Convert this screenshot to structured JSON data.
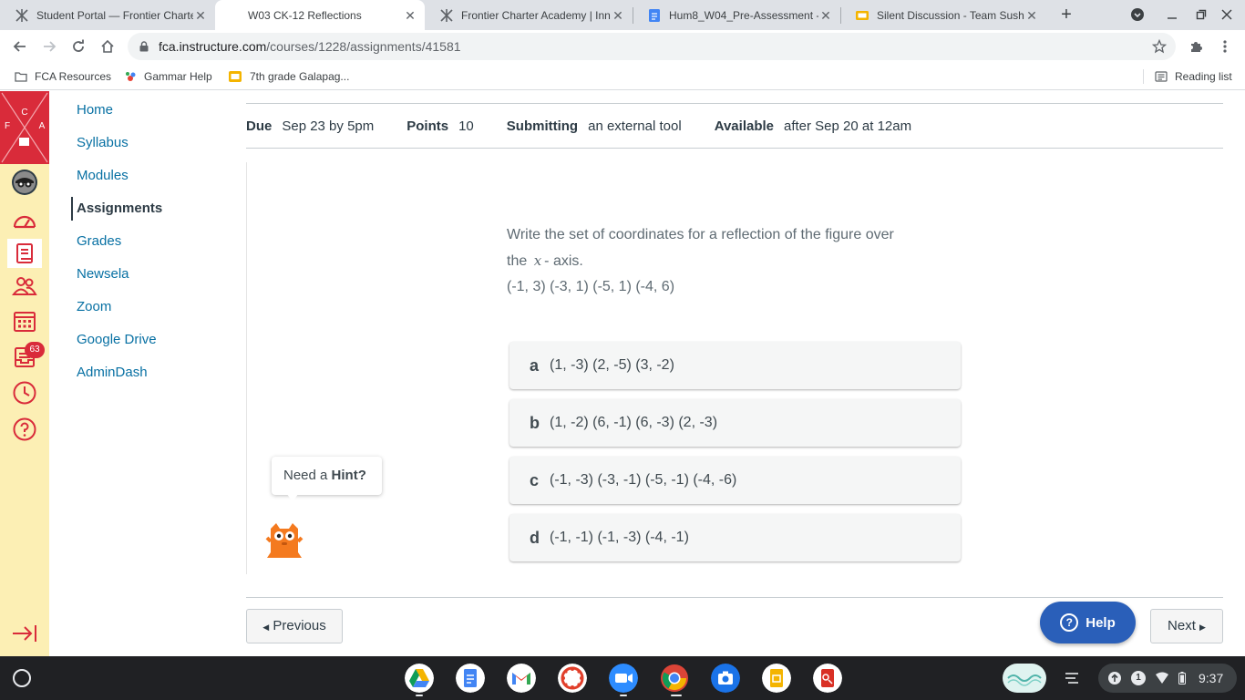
{
  "browser": {
    "tabs": [
      {
        "title": "Student Portal — Frontier Charter",
        "active": false
      },
      {
        "title": "W03 CK-12 Reflections",
        "active": true
      },
      {
        "title": "Frontier Charter Academy | Inn",
        "active": false
      },
      {
        "title": "Hum8_W04_Pre-Assessment -",
        "active": false
      },
      {
        "title": "Silent Discussion - Team Sushi",
        "active": false
      }
    ],
    "url_host": "fca.instructure.com",
    "url_path": "/courses/1228/assignments/41581",
    "bookmarks": [
      "FCA Resources",
      "Gammar Help",
      "7th grade Galapag..."
    ],
    "reading_list": "Reading list",
    "colors": {
      "tabstrip": "#dee1e6",
      "omnibox": "#f1f3f4"
    }
  },
  "global_nav": {
    "brand_letters": [
      "C",
      "F",
      "A"
    ],
    "icons": [
      "account-icon",
      "dashboard-icon",
      "courses-icon",
      "groups-icon",
      "calendar-icon",
      "inbox-icon",
      "history-icon",
      "help-icon"
    ],
    "inbox_badge": "63",
    "colors": {
      "background": "#fcefb4",
      "brand": "#d92b3a"
    }
  },
  "course_nav": {
    "items": [
      {
        "label": "Home"
      },
      {
        "label": "Syllabus"
      },
      {
        "label": "Modules"
      },
      {
        "label": "Assignments",
        "current": true
      },
      {
        "label": "Grades"
      },
      {
        "label": "Newsela"
      },
      {
        "label": "Zoom"
      },
      {
        "label": "Google Drive"
      },
      {
        "label": "AdminDash"
      }
    ],
    "link_color": "#0770a3"
  },
  "assignment": {
    "due_label": "Due",
    "due_value": "Sep 23 by 5pm",
    "points_label": "Points",
    "points_value": "10",
    "submitting_label": "Submitting",
    "submitting_value": "an external tool",
    "available_label": "Available",
    "available_value": "after Sep 20 at 12am"
  },
  "question": {
    "line1": "Write the set of coordinates for a reflection of the figure over",
    "line2_pre": "the",
    "line2_var": "x",
    "line2_post": "- axis.",
    "points": "(-1, 3) (-3, 1) (-5, 1) (-4, 6)",
    "options": [
      {
        "letter": "a",
        "text": "(1, -3) (2, -5) (3, -2)"
      },
      {
        "letter": "b",
        "text": "(1, -2) (6, -1) (6, -3) (2, -3)"
      },
      {
        "letter": "c",
        "text": "(-1, -3) (-3, -1) (-5, -1) (-4, -6)"
      },
      {
        "letter": "d",
        "text": "(-1, -1) (-1, -3) (-4, -1)"
      }
    ],
    "hint_prefix": "Need a",
    "hint_bold": "Hint?"
  },
  "footer": {
    "previous_label": "Previous",
    "next_label": "Next",
    "help_label": "Help",
    "help_color": "#2a5fb9"
  },
  "shelf": {
    "apps": [
      "google-drive-icon",
      "google-docs-icon",
      "gmail-icon",
      "canvas-icon",
      "zoom-icon",
      "chrome-icon",
      "screen-capture-icon",
      "google-slides-icon",
      "app-icon"
    ],
    "notification_count": "1",
    "clock": "9:37"
  }
}
